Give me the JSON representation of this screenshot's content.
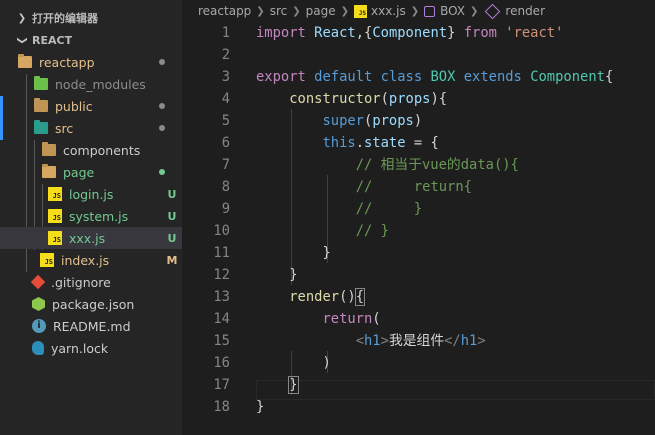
{
  "sidebar": {
    "open_editors_label": "打开的编辑器",
    "project_label": "REACT",
    "items": [
      {
        "label": "reactapp",
        "status": ""
      },
      {
        "label": "node_modules",
        "status": ""
      },
      {
        "label": "public",
        "status": ""
      },
      {
        "label": "src",
        "status": ""
      },
      {
        "label": "components",
        "status": ""
      },
      {
        "label": "page",
        "status": ""
      },
      {
        "label": "login.js",
        "status": "U"
      },
      {
        "label": "system.js",
        "status": "U"
      },
      {
        "label": "xxx.js",
        "status": "U"
      },
      {
        "label": "index.js",
        "status": "M"
      },
      {
        "label": ".gitignore",
        "status": ""
      },
      {
        "label": "package.json",
        "status": ""
      },
      {
        "label": "README.md",
        "status": ""
      },
      {
        "label": "yarn.lock",
        "status": ""
      }
    ]
  },
  "breadcrumb": [
    "reactapp",
    "src",
    "page",
    "xxx.js",
    "BOX",
    "render"
  ],
  "editor": {
    "line_numbers": [
      "1",
      "2",
      "3",
      "4",
      "5",
      "6",
      "7",
      "8",
      "9",
      "10",
      "11",
      "12",
      "13",
      "14",
      "15",
      "16",
      "17",
      "18"
    ],
    "lines": [
      [
        "import",
        " ",
        "React",
        ",{",
        "Component",
        "} ",
        "from",
        " ",
        "'react'"
      ],
      [],
      [
        "export",
        " ",
        "default",
        " ",
        "class",
        " ",
        "BOX",
        " ",
        "extends",
        " ",
        "Component",
        "{"
      ],
      [
        "    ",
        "constructor",
        "(",
        "props",
        "){"
      ],
      [
        "        ",
        "super",
        "(",
        "props",
        ")"
      ],
      [
        "        ",
        "this",
        ".",
        "state",
        " = {"
      ],
      [
        "            ",
        "// 相当于vue的data(){"
      ],
      [
        "            ",
        "//     return{"
      ],
      [
        "            ",
        "//     }"
      ],
      [
        "            ",
        "// }"
      ],
      [
        "        ",
        "}"
      ],
      [
        "    ",
        "}"
      ],
      [
        "    ",
        "render",
        "()",
        "{"
      ],
      [
        "        ",
        "return",
        "("
      ],
      [
        "            ",
        "<",
        "h1",
        ">",
        "我是组件",
        "</",
        "h1",
        ">"
      ],
      [
        "        ",
        ")"
      ],
      [
        "    ",
        "}"
      ],
      [
        "}"
      ]
    ]
  }
}
